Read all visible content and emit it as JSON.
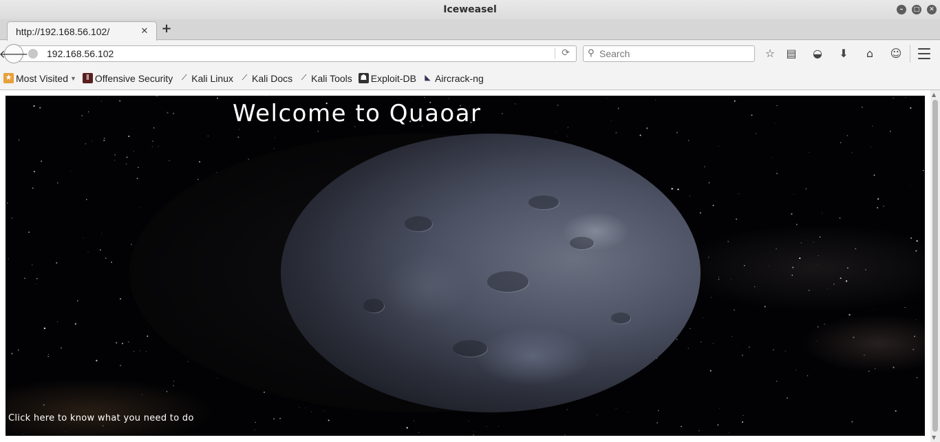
{
  "window": {
    "title": "Iceweasel",
    "controls": [
      "minimize-icon",
      "maximize-icon",
      "close-icon"
    ]
  },
  "tabs": [
    {
      "label": "http://192.168.56.102/",
      "active": true
    }
  ],
  "navbar": {
    "url": "192.168.56.102",
    "search_placeholder": "Search",
    "icons": [
      "back-icon",
      "site-identity-icon",
      "reload-icon",
      "search-icon",
      "bookmark-star-icon",
      "reading-list-icon",
      "pocket-icon",
      "downloads-icon",
      "home-icon",
      "chat-icon",
      "menu-icon"
    ]
  },
  "bookmarks": [
    {
      "label": "Most Visited",
      "icon": "most-visited-icon",
      "dropdown": true
    },
    {
      "label": "Offensive Security",
      "icon": "offensive-security-icon"
    },
    {
      "label": "Kali Linux",
      "icon": "kali-dragon-icon"
    },
    {
      "label": "Kali Docs",
      "icon": "kali-dragon-icon"
    },
    {
      "label": "Kali Tools",
      "icon": "kali-dragon-icon"
    },
    {
      "label": "Exploit-DB",
      "icon": "exploit-db-icon"
    },
    {
      "label": "Aircrack-ng",
      "icon": "aircrack-icon"
    }
  ],
  "page": {
    "title": "Welcome to Quaoar",
    "link_text": "Click here to know what you need to do",
    "background_color": "#020204"
  }
}
